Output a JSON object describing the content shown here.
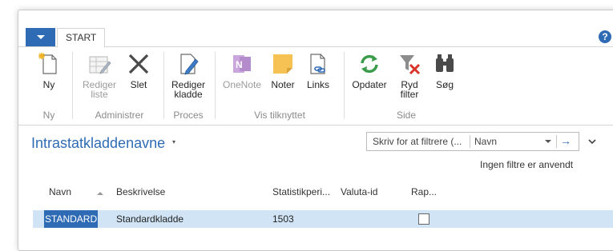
{
  "tabs": {
    "start": "START"
  },
  "help": "?",
  "ribbon": {
    "ny": "Ny",
    "rediger_liste_1": "Rediger",
    "rediger_liste_2": "liste",
    "slet": "Slet",
    "rediger_kladde_1": "Rediger",
    "rediger_kladde_2": "kladde",
    "onenote": "OneNote",
    "noter": "Noter",
    "links": "Links",
    "opdater": "Opdater",
    "ryd_filter_1": "Ryd",
    "ryd_filter_2": "filter",
    "sog": "Søg",
    "groups": {
      "ny": "Ny",
      "administrer": "Administrer",
      "proces": "Proces",
      "vis_tilknyttet": "Vis tilknyttet",
      "side": "Side"
    }
  },
  "page": {
    "title": "Intrastatkladdenavne",
    "caret": "▾"
  },
  "filter": {
    "input_text": "Skriv for at filtrere (...",
    "field": "Navn",
    "go": "→",
    "status": "Ingen filtre er anvendt"
  },
  "table": {
    "columns": [
      "Navn",
      "Beskrivelse",
      "Statistikperi...",
      "Valuta-id",
      "Rap..."
    ],
    "rows": [
      {
        "navn": "STANDARD",
        "beskrivelse": "Standardkladde",
        "statistikperiode": "1503",
        "valuta": "",
        "rapporteret": false
      }
    ]
  },
  "colors": {
    "accent": "#2f6bb5",
    "selected_row": "#d1e4f5",
    "onenote": "#9b5bb5",
    "noter": "#f2c04d",
    "refresh": "#3a9b4b",
    "clear": "#d9342b"
  }
}
